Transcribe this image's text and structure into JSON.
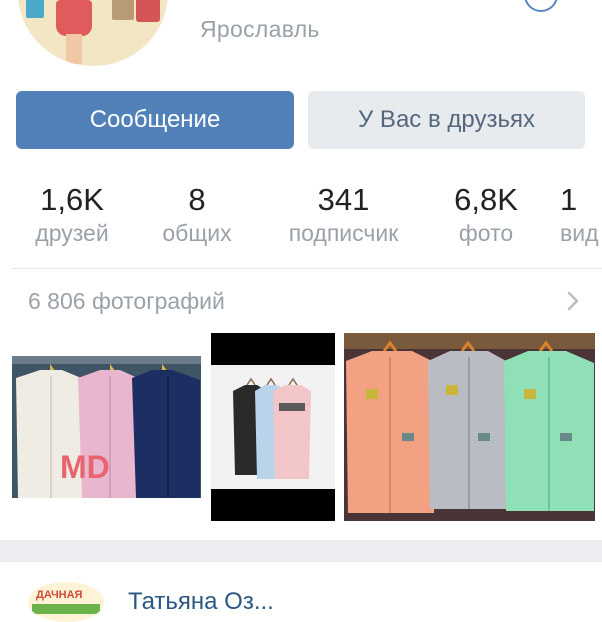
{
  "profile": {
    "city": "Ярославль"
  },
  "actions": {
    "message_label": "Сообщение",
    "friends_label": "У Вас в друзьях"
  },
  "counters": [
    {
      "value": "1,6K",
      "label": "друзей"
    },
    {
      "value": "8",
      "label": "общих"
    },
    {
      "value": "341",
      "label": "подписчик"
    },
    {
      "value": "6,8K",
      "label": "фото"
    },
    {
      "value": "1",
      "label": "вид"
    }
  ],
  "photos": {
    "title": "6 806 фотографий",
    "first_overlay_text": "MD"
  },
  "post": {
    "author_partial": "Татьяна Оз...",
    "avatar_text": "ДАЧНАЯ"
  },
  "colors": {
    "accent": "#5181b8",
    "muted_text": "#9aa1a8",
    "link": "#2a5885"
  },
  "icons": {
    "photos_chevron": "chevron-right-icon"
  }
}
